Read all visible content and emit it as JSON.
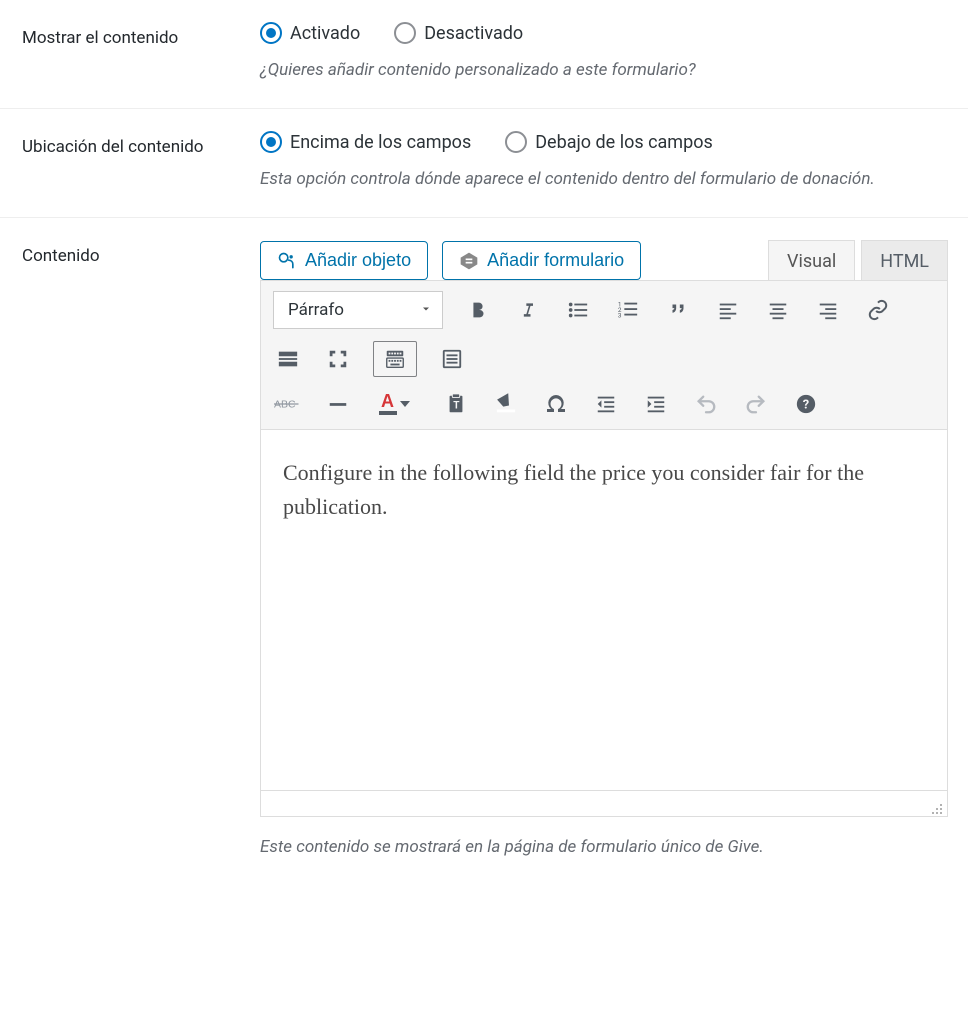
{
  "row_show": {
    "label": "Mostrar el contenido",
    "opt_on": "Activado",
    "opt_off": "Desactivado",
    "help": "¿Quieres añadir contenido personalizado a este formulario?"
  },
  "row_loc": {
    "label": "Ubicación del contenido",
    "opt_above": "Encima de los campos",
    "opt_below": "Debajo de los campos",
    "help": "Esta opción controla dónde aparece el contenido dentro del formulario de donación."
  },
  "row_content": {
    "label": "Contenido",
    "btn_add_object": "Añadir objeto",
    "btn_add_form": "Añadir formulario",
    "tab_visual": "Visual",
    "tab_html": "HTML",
    "format_select": "Párrafo",
    "body": "Configure in the following field the price you consider fair for the publication.",
    "help": "Este contenido se mostrará en la página de formulario único de Give."
  },
  "icons": {
    "media": "media-icon",
    "form": "form-icon"
  }
}
